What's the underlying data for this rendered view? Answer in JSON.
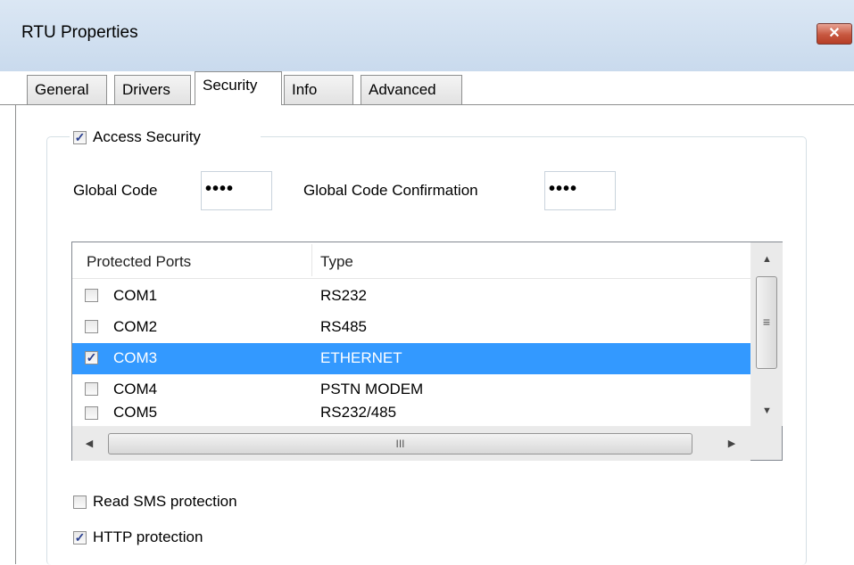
{
  "window": {
    "title": "RTU Properties",
    "close_label": "✕"
  },
  "tabs": [
    {
      "label": "General",
      "active": false
    },
    {
      "label": "Drivers",
      "active": false
    },
    {
      "label": "Security",
      "active": true
    },
    {
      "label": "Info",
      "active": false
    },
    {
      "label": "Advanced",
      "active": false
    }
  ],
  "security": {
    "access_security": {
      "label": "Access Security",
      "checked": true
    },
    "global_code": {
      "label": "Global Code",
      "value": "••••"
    },
    "global_code_confirmation": {
      "label": "Global Code Confirmation",
      "value": "••••"
    },
    "ports_table": {
      "columns": [
        "Protected Ports",
        "Type"
      ],
      "rows": [
        {
          "port": "COM1",
          "type": "RS232",
          "checked": false,
          "selected": false
        },
        {
          "port": "COM2",
          "type": "RS485",
          "checked": false,
          "selected": false
        },
        {
          "port": "COM3",
          "type": "ETHERNET",
          "checked": true,
          "selected": true
        },
        {
          "port": "COM4",
          "type": "PSTN MODEM",
          "checked": false,
          "selected": false
        },
        {
          "port": "COM5",
          "type": "RS232/485",
          "checked": false,
          "selected": false
        }
      ],
      "hthumb_grip": "III",
      "vthumb_grip": "≡"
    },
    "read_sms": {
      "label": "Read SMS protection",
      "checked": false
    },
    "http": {
      "label": "HTTP protection",
      "checked": true
    }
  },
  "colors": {
    "selection": "#3399ff",
    "title_bar": "#dbe7f4",
    "close_button": "#c7573f"
  },
  "icons": {
    "check": "✓",
    "close": "close-icon",
    "scroll_up": "▲",
    "scroll_down": "▼",
    "scroll_left": "◀",
    "scroll_right": "▶"
  }
}
